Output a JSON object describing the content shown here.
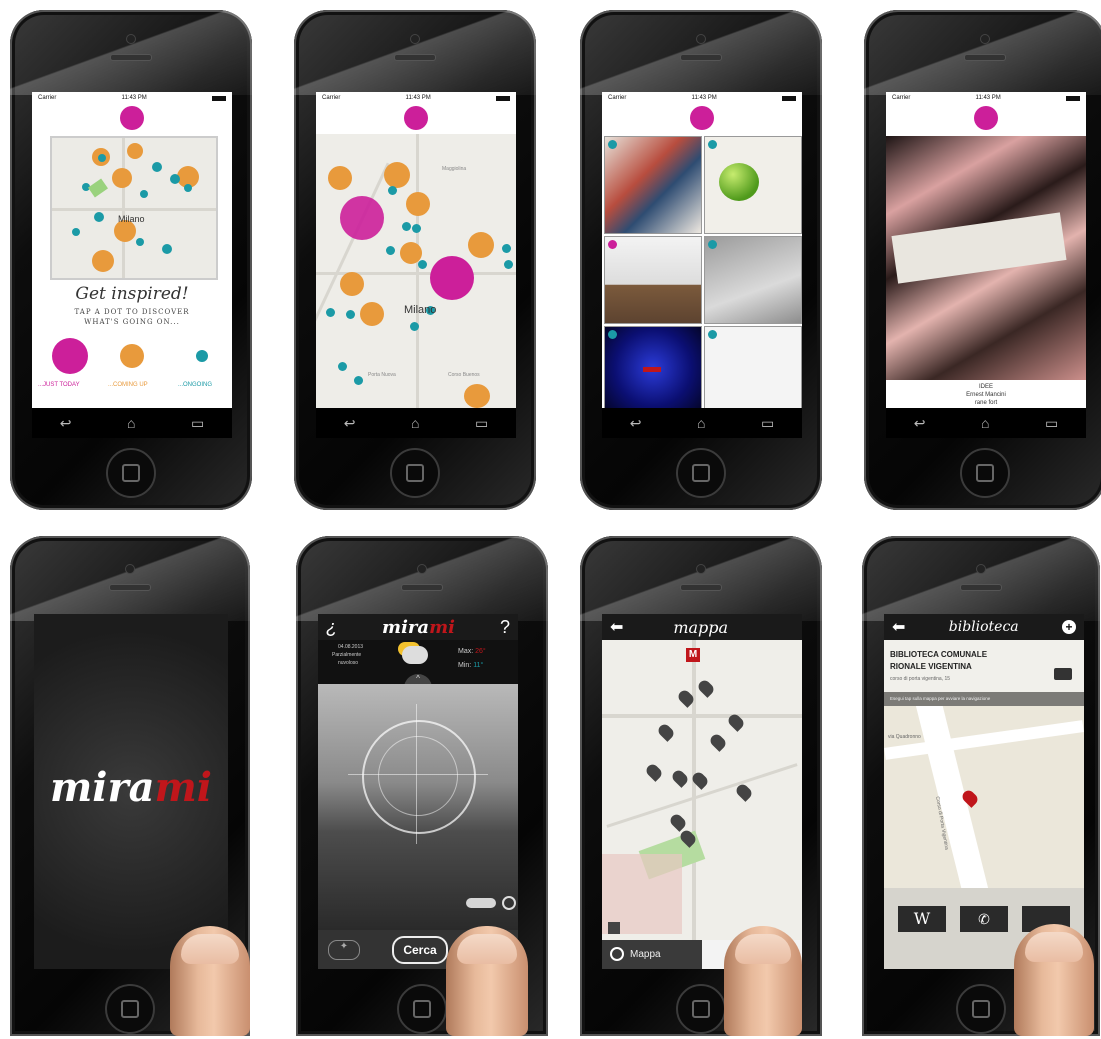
{
  "colors": {
    "magenta": "#cc1f9a",
    "orange": "#e89a3c",
    "teal": "#1b9aa6",
    "red": "#c0161b"
  },
  "status": {
    "carrier": "Carrier",
    "time": "11:43 PM"
  },
  "phone1": {
    "map_label": "Milano",
    "headline": "Get inspired!",
    "subtitle_line1": "Tap a dot to discover",
    "subtitle_line2": "what's going on...",
    "legend": [
      "...JUST TODAY",
      "...COMING UP",
      "...ONGOING"
    ]
  },
  "phone2": {
    "map_label": "Milano",
    "labels": [
      "Maggiolina",
      "Porta Nuova",
      "Corso Buenos"
    ]
  },
  "phone4": {
    "caption_line1": "IDEE",
    "caption_line2": "Ernest Mancini",
    "caption_line3": "rane fort"
  },
  "phone5": {
    "logo_part1": "mira",
    "logo_part2": "mi"
  },
  "phone6": {
    "left_symbol": "¿",
    "logo_part1": "mira",
    "logo_part2": "mi",
    "help_symbol": "?",
    "date": "04.08.2013",
    "forecast_line1": "Parzialmente",
    "forecast_line2": "nuvoloso",
    "max_label": "Max:",
    "max_value": "26°",
    "min_label": "Min:",
    "min_value": "11°",
    "search_button": "Cerca"
  },
  "phone7": {
    "title": "mappa",
    "tab_label": "Mappa",
    "station": "M"
  },
  "phone8": {
    "title": "biblioteca",
    "name_line1": "BIBLIOTECA COMUNALE",
    "name_line2": "RIONALE VIGENTINA",
    "address": "corso di porta vigentina, 15",
    "hint": "Esegui tap sulla mappa per avviare la navigazione",
    "street1": "via Quadronno",
    "street2": "Corso di Porta Vigentina",
    "wiki_label": "W",
    "phone_label": "✆"
  }
}
